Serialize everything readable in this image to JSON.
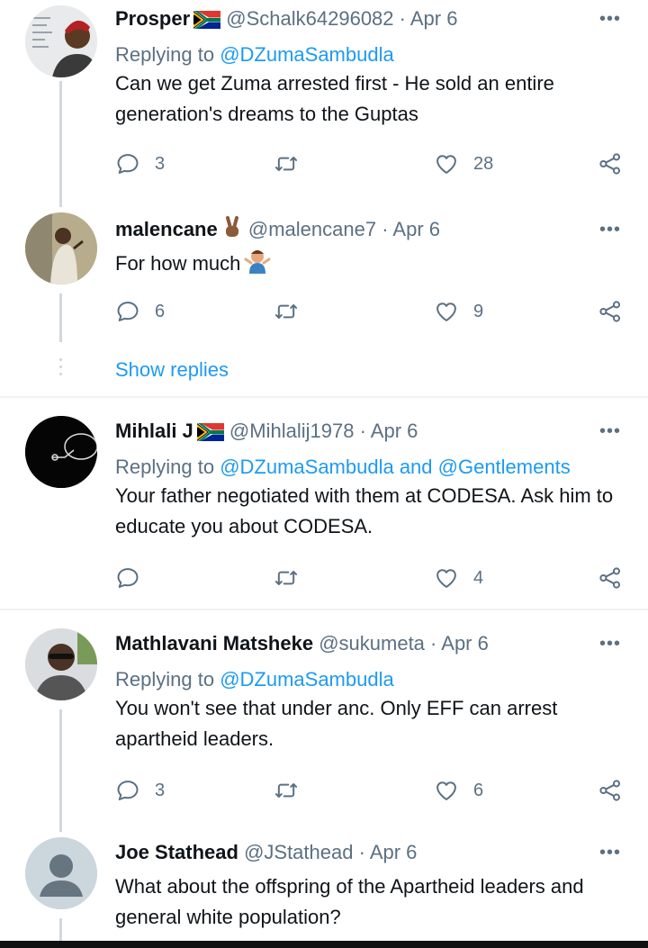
{
  "tweets": [
    {
      "name": "Prosper",
      "handle": "@Schalk64296082",
      "date": "· Apr 6",
      "replying_label": "Replying to ",
      "replying_to": "@DZumaSambudla",
      "text": "Can we get Zuma arrested first - He sold an entire generation's dreams to the Guptas",
      "replies": "3",
      "retweets": "",
      "likes": "28"
    },
    {
      "name": "malencane",
      "handle": "@malencane7",
      "date": "· Apr 6",
      "text": "For how much",
      "replies": "6",
      "retweets": "",
      "likes": "9"
    },
    {
      "name": "Mihlali J",
      "handle": "@Mihlalij1978",
      "date": "· Apr 6",
      "replying_label": "Replying to ",
      "replying_to": "@DZumaSambudla and @Gentlements",
      "text": "Your father negotiated with them at CODESA. Ask him to educate you about CODESA.",
      "replies": "",
      "retweets": "",
      "likes": "4"
    },
    {
      "name": "Mathlavani Matsheke",
      "handle": "@sukumeta",
      "date": "· Apr 6",
      "replying_label": "Replying to ",
      "replying_to": "@DZumaSambudla",
      "text": "You won't see that under anc. Only EFF can arrest apartheid leaders.",
      "replies": "3",
      "retweets": "",
      "likes": "6"
    },
    {
      "name": "Joe Stathead",
      "handle": "@JStathead",
      "date": "· Apr 6",
      "text": "What about the offspring of the Apartheid leaders and general white population?"
    }
  ],
  "show_replies": "Show replies",
  "more_glyph": "•••",
  "icons": [
    "reply-icon",
    "retweet-icon",
    "like-icon",
    "share-icon",
    "more-icon",
    "south-africa-flag-icon",
    "peace-hand-emoji",
    "shrug-emoji"
  ],
  "colors": {
    "link": "#1d9bf0",
    "muted": "#5b7083",
    "text": "#0f1419",
    "line": "#cfd9de"
  }
}
